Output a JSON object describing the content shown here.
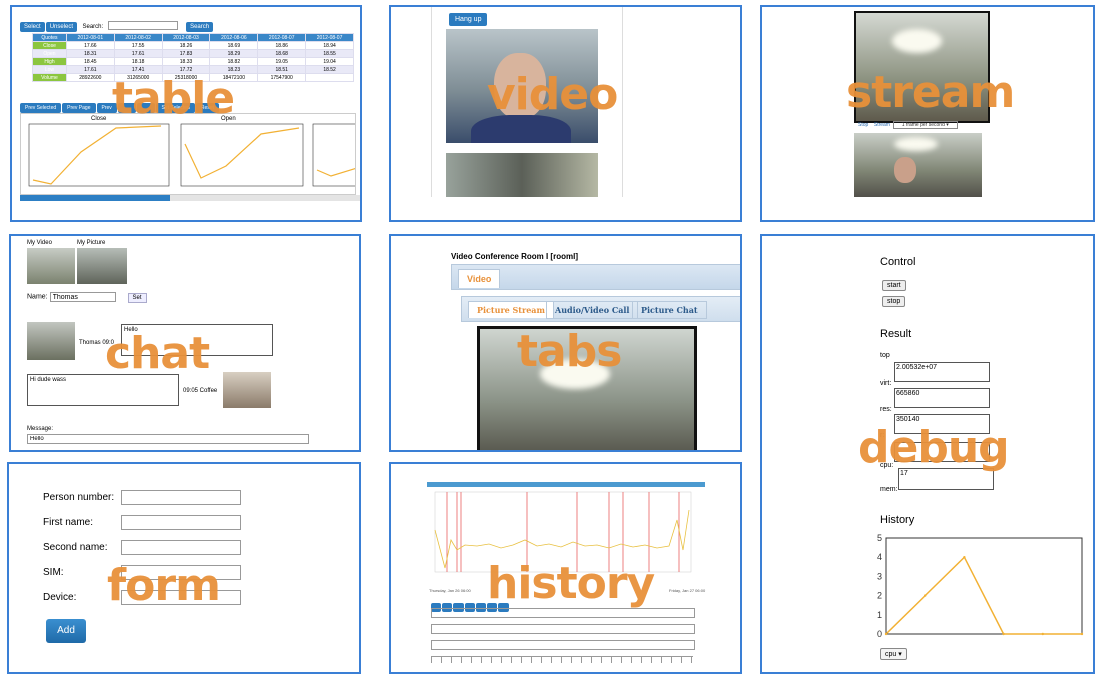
{
  "labels": {
    "table": "table",
    "video": "video",
    "stream": "stream",
    "chat": "chat",
    "tabs": "tabs",
    "debug": "debug",
    "form": "form",
    "history": "history"
  },
  "table": {
    "select": "Select",
    "unselect": "Unselect",
    "search_label": "Search:",
    "search": "Search",
    "columns": [
      "Quotes",
      "2012-08-01",
      "2012-08-02",
      "2012-08-03",
      "2012-08-06",
      "2012-08-07",
      "2012-08-07"
    ],
    "rows": [
      [
        "Close",
        "17.66",
        "17.55",
        "18.26",
        "18.69",
        "18.86",
        "18.94"
      ],
      [
        "Open",
        "18.31",
        "17.61",
        "17.83",
        "18.29",
        "18.68",
        "18.55"
      ],
      [
        "High",
        "18.45",
        "18.18",
        "18.33",
        "18.82",
        "19.05",
        "19.04"
      ],
      [
        "Low",
        "17.61",
        "17.41",
        "17.72",
        "18.23",
        "18.51",
        "18.52"
      ],
      [
        "Volume",
        "28922600",
        "31265000",
        "25318000",
        "18472100",
        "17547900",
        ""
      ]
    ],
    "pager": [
      "Prev Selected",
      "Prev Page",
      "Prev",
      "",
      "",
      "Set Selected",
      "Reset"
    ],
    "chart_titles": [
      "Close",
      "Open"
    ]
  },
  "video": {
    "hangup": "Hang up"
  },
  "stream": {
    "stop": "Stop",
    "stream": "Stream",
    "rate": "1 frame per second"
  },
  "chat": {
    "my_video": "My Video",
    "my_picture": "My Picture",
    "name_label": "Name:",
    "name_value": "Thomas",
    "set": "Set",
    "msg1_meta": "Thomas 09:0",
    "msg1": "Hello",
    "msg2": "Hi dude wass",
    "msg2_meta": "09:05 Coffee",
    "message_label": "Message:",
    "message_value": "Hello"
  },
  "tabs": {
    "room": "Video Conference Room I [rooml]",
    "outer_tab": "Video",
    "inner_tabs": [
      "Picture Stream",
      "Audio/Video Call",
      "Picture Chat"
    ]
  },
  "form": {
    "fields": [
      "Person number:",
      "First name:",
      "Second name:",
      "SIM:",
      "Device:"
    ],
    "add": "Add"
  },
  "history": {
    "left_date": "Thursday, Jan 26 06:00",
    "right_date": "Friday, Jan 27 06:00"
  },
  "debug": {
    "control": "Control",
    "start": "start",
    "stop": "stop",
    "result": "Result",
    "top_label": "top",
    "virt": "virt:",
    "virt_val": "2.00532e+07",
    "res": "res:",
    "res_val": "665860",
    "shr": "r:",
    "shr_val": "350140",
    "cpu": "cpu:",
    "cpu_val": "",
    "mem": "mem:",
    "mem_val": "17",
    "history": "History",
    "select": "cpu"
  },
  "chart_data": {
    "type": "line",
    "x": [
      0,
      1,
      2,
      3,
      4,
      5
    ],
    "y": [
      0,
      2,
      4,
      0,
      0,
      0
    ],
    "yticks": [
      0,
      1,
      2,
      3,
      4,
      5
    ],
    "ylim": [
      0,
      5
    ],
    "color": "#f2b134"
  }
}
